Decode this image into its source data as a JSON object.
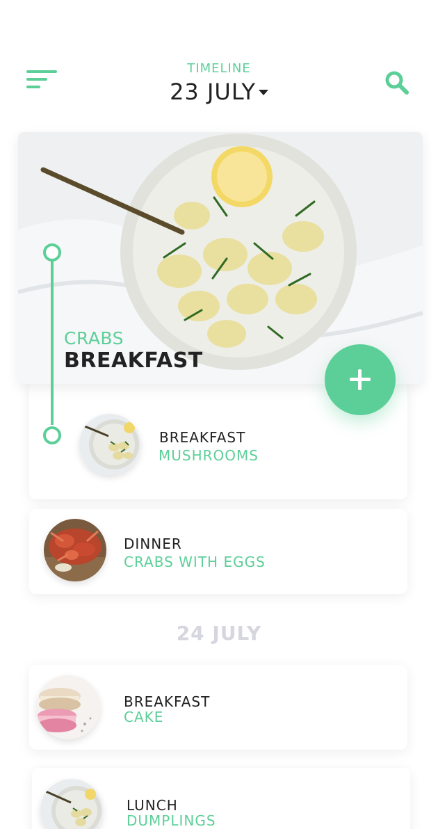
{
  "header": {
    "subtitle": "TIMELINE",
    "date": "23 JULY",
    "menu_icon": "hamburger-menu-icon",
    "search_icon": "search-icon"
  },
  "featured": {
    "subtitle": "CRABS",
    "title": "BREAKFAST"
  },
  "add_button_icon": "plus-icon",
  "accent_color": "#5ccf98",
  "days": [
    {
      "meals": [
        {
          "type": "BREAKFAST",
          "name": "MUSHROOMS"
        },
        {
          "type": "DINNER",
          "name": "CRABS WITH EGGS"
        }
      ]
    },
    {
      "label": "24 JULY",
      "meals": [
        {
          "type": "BREAKFAST",
          "name": "CAKE"
        },
        {
          "type": "LUNCH",
          "name": "DUMPLINGS"
        }
      ]
    }
  ]
}
